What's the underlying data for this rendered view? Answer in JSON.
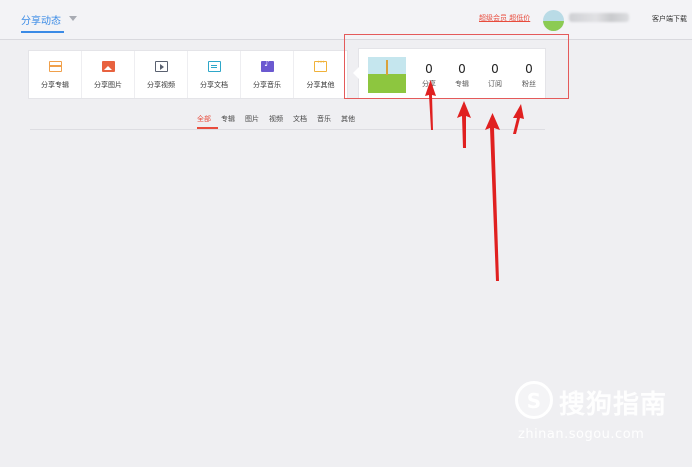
{
  "header": {
    "nav_title": "分享动态",
    "vip_link": "超级会员 超低价",
    "client_download": "客户端下载"
  },
  "share_toolbar": {
    "items": [
      {
        "label": "分享专辑",
        "icon": "album-icon"
      },
      {
        "label": "分享图片",
        "icon": "photo-icon"
      },
      {
        "label": "分享视频",
        "icon": "video-icon"
      },
      {
        "label": "分享文档",
        "icon": "document-icon"
      },
      {
        "label": "分享音乐",
        "icon": "music-icon"
      },
      {
        "label": "分享其他",
        "icon": "other-icon"
      }
    ]
  },
  "stats": [
    {
      "value": "0",
      "label": "分享"
    },
    {
      "value": "0",
      "label": "专辑"
    },
    {
      "value": "0",
      "label": "订阅"
    },
    {
      "value": "0",
      "label": "粉丝"
    }
  ],
  "filters": {
    "tabs": [
      "全部",
      "专辑",
      "图片",
      "视频",
      "文档",
      "音乐",
      "其他"
    ],
    "active_index": 0
  },
  "watermark": {
    "brand": "搜狗指南",
    "url": "zhinan.sogou.com",
    "logo_letter": "S"
  },
  "colors": {
    "accent_blue": "#3b8be6",
    "accent_red": "#e84c3d",
    "annotation_red": "#e02020"
  }
}
